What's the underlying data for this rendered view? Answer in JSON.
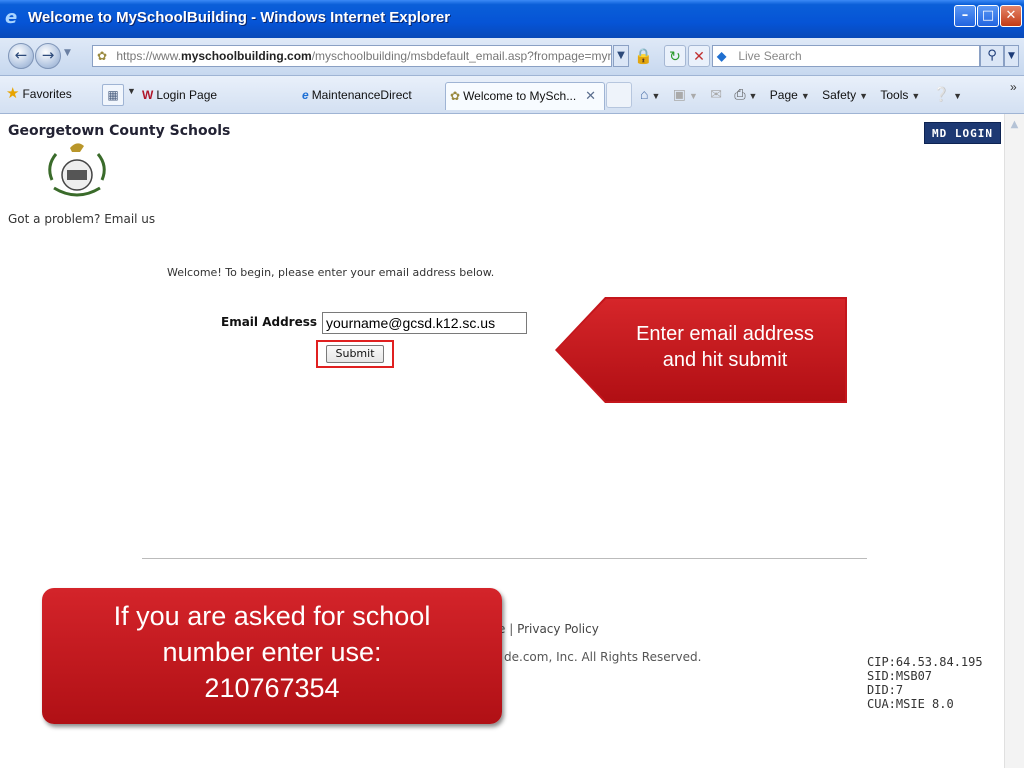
{
  "window": {
    "title": "Welcome to MySchoolBuilding - Windows Internet Explorer",
    "min_icon": "minimize-icon",
    "max_icon": "maximize-icon",
    "close_icon": "close-icon"
  },
  "address_bar": {
    "url_prefix": "https://www.",
    "url_host": "myschoolbuilding.com",
    "url_path": "/myschoolbuilding/msbdefault_email.asp?frompage=myreques",
    "search_placeholder": "Live Search"
  },
  "tab_bar": {
    "favorites_label": "Favorites",
    "tabs": [
      {
        "label": "Login Page",
        "icon": "w-site-icon"
      },
      {
        "label": "MaintenanceDirect",
        "icon": "ie-icon"
      },
      {
        "label": "Welcome to MySch...",
        "icon": "site-icon",
        "active": true
      }
    ],
    "commands": [
      "Page",
      "Safety",
      "Tools"
    ]
  },
  "page": {
    "org_name": "Georgetown County Schools",
    "md_login_label": "MD LOGIN",
    "problem_text": "Got a problem?",
    "email_us_link": "Email us",
    "welcome_text": "Welcome! To begin, please enter your email address below.",
    "email_label": "Email Address",
    "email_value": "yourname@gcsd.k12.sc.us",
    "submit_label": "Submit",
    "footer_links_tail": "e | ",
    "privacy_link": "Privacy Policy",
    "copyright_text": "de.com, Inc. All Rights Reserved.",
    "diagnostics": {
      "cip": "CIP:64.53.84.195",
      "sid": "SID:MSB07",
      "did": "DID:7",
      "cua": "CUA:MSIE 8.0"
    }
  },
  "callouts": {
    "right_text_line1": "Enter email address",
    "right_text_line2": "and hit submit",
    "left_text_line1": "If you are asked for school",
    "left_text_line2": "number enter use:",
    "left_text_line3": "210767354"
  },
  "colors": {
    "titlebar": "#0654d6",
    "callout_red": "#c4161c",
    "md_login_bg": "#1d3973"
  }
}
